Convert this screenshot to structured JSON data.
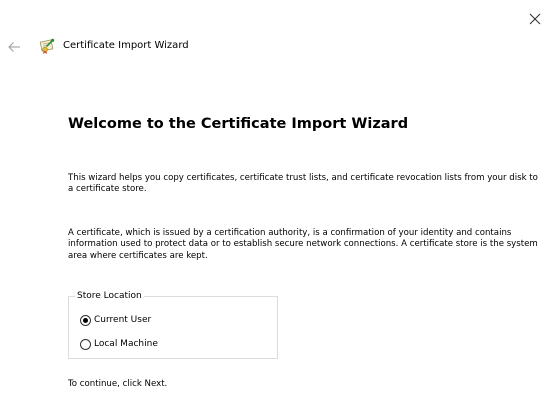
{
  "window": {
    "title": "Certificate Import Wizard",
    "close_icon": "close-icon",
    "back_icon": "back-arrow-icon",
    "app_icon": "certificate-icon"
  },
  "welcome": {
    "heading": "Welcome to the Certificate Import Wizard",
    "paragraph1": "This wizard helps you copy certificates, certificate trust lists, and certificate revocation lists from your disk to a certificate store.",
    "paragraph2": "A certificate, which is issued by a certification authority, is a confirmation of your identity and contains information used to protect data or to establish secure network connections. A certificate store is the system area where certificates are kept."
  },
  "store_location": {
    "legend": "Store Location",
    "options": [
      {
        "label": "Current User",
        "selected": true
      },
      {
        "label": "Local Machine",
        "selected": false
      }
    ]
  },
  "footer": {
    "instruction": "To continue, click Next."
  },
  "colors": {
    "background": "#ffffff",
    "text": "#000000",
    "groupbox_border": "#dcdcdc",
    "back_arrow": "#a0a0a0"
  }
}
